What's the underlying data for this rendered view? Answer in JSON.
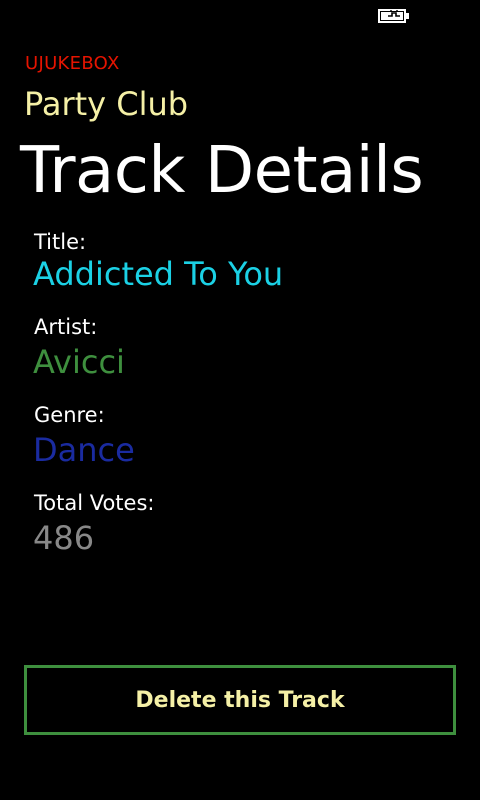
{
  "colors": {
    "background": "#000000",
    "app_name": "#e51400",
    "subtitle": "#f5f0a6",
    "title": "#ffffff",
    "label": "#ffffff",
    "title_value": "#1bd1e5",
    "artist_value": "#3e8f3e",
    "genre_value": "#1a2ba0",
    "votes_value": "#888888",
    "button_border": "#3e8f3e",
    "button_text": "#f5f0a6"
  },
  "status_bar": {
    "battery_icon": "battery-charging-icon"
  },
  "header": {
    "app_name": "UJUKEBOX",
    "subtitle": "Party Club",
    "title": "Track Details"
  },
  "track": {
    "title_label": "Title:",
    "title_value": "Addicted To You",
    "artist_label": "Artist:",
    "artist_value": "Avicci",
    "genre_label": "Genre:",
    "genre_value": "Dance",
    "votes_label": "Total Votes:",
    "votes_value": "486"
  },
  "actions": {
    "delete_label": "Delete this Track"
  }
}
